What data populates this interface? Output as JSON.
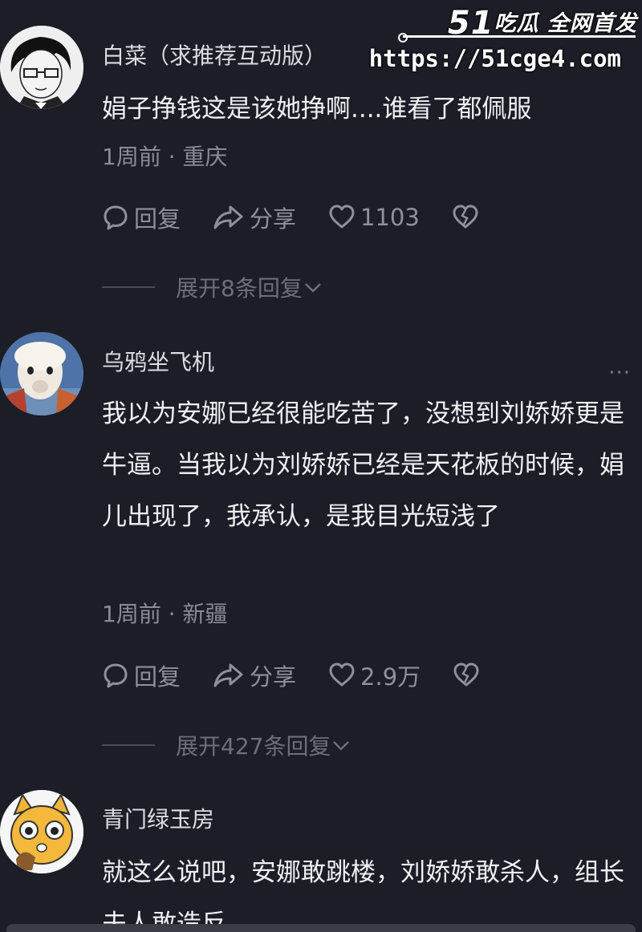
{
  "watermark": {
    "brand_number": "51",
    "brand_text": "吃瓜 全网首发",
    "url": "https://51cge4.com"
  },
  "comments": [
    {
      "username": "白菜（求推荐互动版）",
      "text": "娟子挣钱这是该她挣啊....谁看了都佩服",
      "time_location": "1周前 · 重庆",
      "reply_label": "回复",
      "share_label": "分享",
      "likes": "1103",
      "expand_label": "展开8条回复"
    },
    {
      "username": "乌鸦坐飞机",
      "text": "我以为安娜已经很能吃苦了，没想到刘娇娇更是牛逼。当我以为刘娇娇已经是天花板的时候，娟儿出现了，我承认，是我目光短浅了",
      "time_location": "1周前 · 新疆",
      "reply_label": "回复",
      "share_label": "分享",
      "likes": "2.9万",
      "expand_label": "展开427条回复",
      "more_label": "···"
    },
    {
      "username": "青门绿玉房",
      "text": "就这么说吧，安娜敢跳楼，刘娇娇敢杀人，组长夫人敢造反"
    }
  ],
  "colors": {
    "background": "#1c1d26",
    "text_primary": "#f0f0f4",
    "text_secondary": "#8a8b95"
  },
  "icons": [
    "reply-bubble-icon",
    "share-arrow-icon",
    "heart-icon",
    "broken-heart-icon",
    "more-dots-icon",
    "chevron-down-icon"
  ]
}
